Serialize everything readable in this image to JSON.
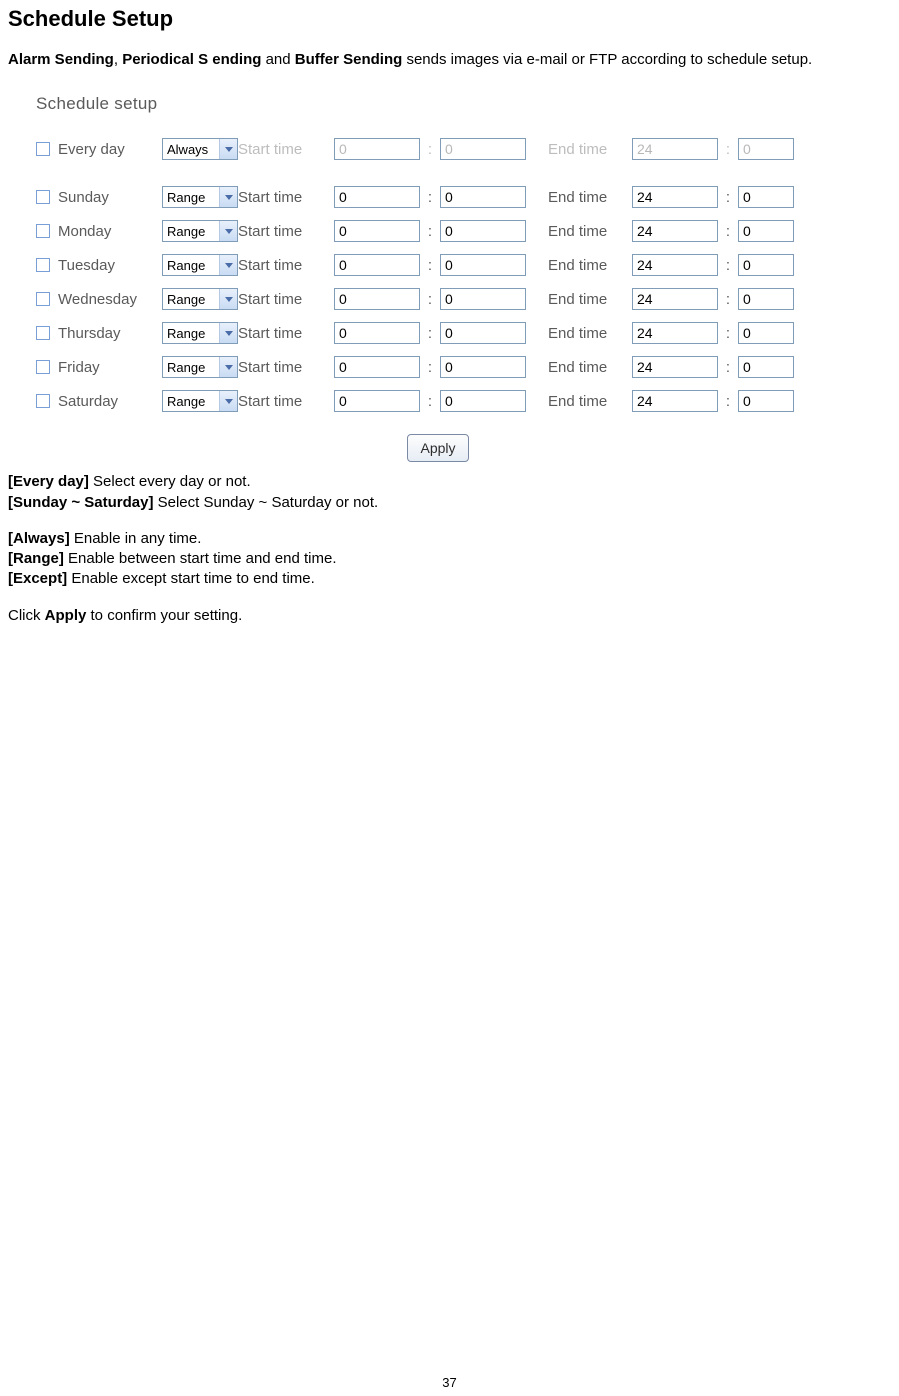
{
  "title": "Schedule Setup",
  "intro": {
    "seg1": "Alarm Sending",
    "comma": ", ",
    "seg2": "Periodical S ending",
    "and": " and ",
    "seg3": "Buffer Sending",
    "tail": " sends images via e-mail or FTP according to schedule setup."
  },
  "figure": {
    "heading": "Schedule setup",
    "labels": {
      "start": "Start time",
      "end": "End time",
      "colon": ":"
    },
    "apply": "Apply",
    "every": {
      "name": "Every day",
      "mode": "Always",
      "sh": "0",
      "sm": "0",
      "eh": "24",
      "em": "0"
    },
    "days": [
      {
        "name": "Sunday",
        "mode": "Range",
        "sh": "0",
        "sm": "0",
        "eh": "24",
        "em": "0"
      },
      {
        "name": "Monday",
        "mode": "Range",
        "sh": "0",
        "sm": "0",
        "eh": "24",
        "em": "0"
      },
      {
        "name": "Tuesday",
        "mode": "Range",
        "sh": "0",
        "sm": "0",
        "eh": "24",
        "em": "0"
      },
      {
        "name": "Wednesday",
        "mode": "Range",
        "sh": "0",
        "sm": "0",
        "eh": "24",
        "em": "0"
      },
      {
        "name": "Thursday",
        "mode": "Range",
        "sh": "0",
        "sm": "0",
        "eh": "24",
        "em": "0"
      },
      {
        "name": "Friday",
        "mode": "Range",
        "sh": "0",
        "sm": "0",
        "eh": "24",
        "em": "0"
      },
      {
        "name": "Saturday",
        "mode": "Range",
        "sh": "0",
        "sm": "0",
        "eh": "24",
        "em": "0"
      }
    ]
  },
  "defs": {
    "everyday_k": "[Every day]",
    "everyday_v": " Select every day or not.",
    "sunsat_k": "[Sunday ~ Saturday]",
    "sunsat_v": " Select Sunday ~ Saturday or not.",
    "always_k": "[Always]",
    "always_v": " Enable in any time.",
    "range_k": "[Range]",
    "range_v": " Enable between start time and end time.",
    "except_k": "[Except]",
    "except_v": " Enable except start time to end time.",
    "click1": "Click ",
    "click_b": "Apply",
    "click2": " to confirm your setting."
  },
  "page_number": "37"
}
